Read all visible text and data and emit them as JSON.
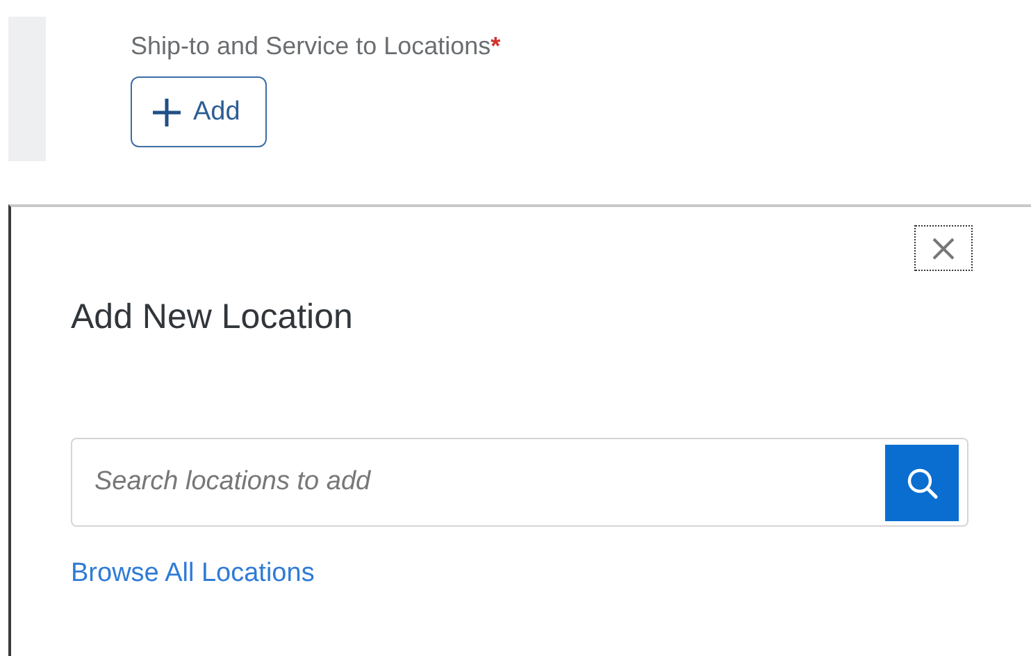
{
  "field": {
    "label": "Ship-to and Service to Locations",
    "required_mark": "*",
    "add_button": "Add"
  },
  "dialog": {
    "title": "Add New Location",
    "search": {
      "placeholder": "Search locations to add"
    },
    "link": "Browse All Locations"
  }
}
